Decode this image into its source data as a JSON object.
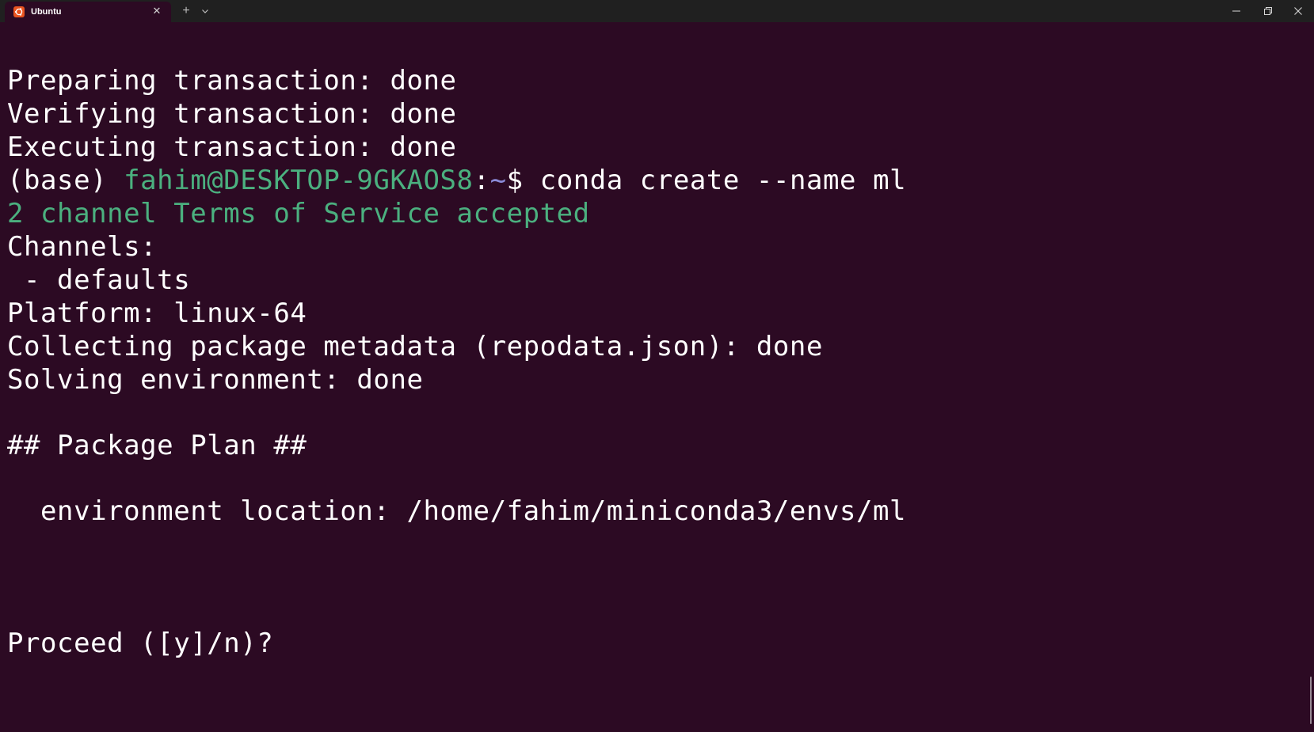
{
  "window": {
    "tab_title": "Ubuntu",
    "tab_icon": "ubuntu-logo-icon",
    "tab_close_glyph": "✕",
    "new_tab_glyph": "+",
    "colors": {
      "titlebar_bg": "#202020",
      "terminal_bg": "#2c0a23",
      "tab_icon_bg": "#e95420",
      "prompt_green": "#4bb07f",
      "text": "#ffffff"
    }
  },
  "terminal": {
    "lines": {
      "l1": "Preparing transaction: done",
      "l2": "Verifying transaction: done",
      "l3": "Executing transaction: done",
      "prompt_env": "(base) ",
      "prompt_user": "fahim@DESKTOP-9GKAOS8",
      "prompt_sep": ":",
      "prompt_path": "~",
      "prompt_dollar": "$ ",
      "command": "conda create --name ml",
      "l5": "2 channel Terms of Service accepted",
      "l6": "Channels:",
      "l7": " - defaults",
      "l8": "Platform: linux-64",
      "l9": "Collecting package metadata (repodata.json): done",
      "l10": "Solving environment: done",
      "l11": "## Package Plan ##",
      "l12": "  environment location: /home/fahim/miniconda3/envs/ml",
      "l13": "Proceed ([y]/n)?"
    }
  }
}
